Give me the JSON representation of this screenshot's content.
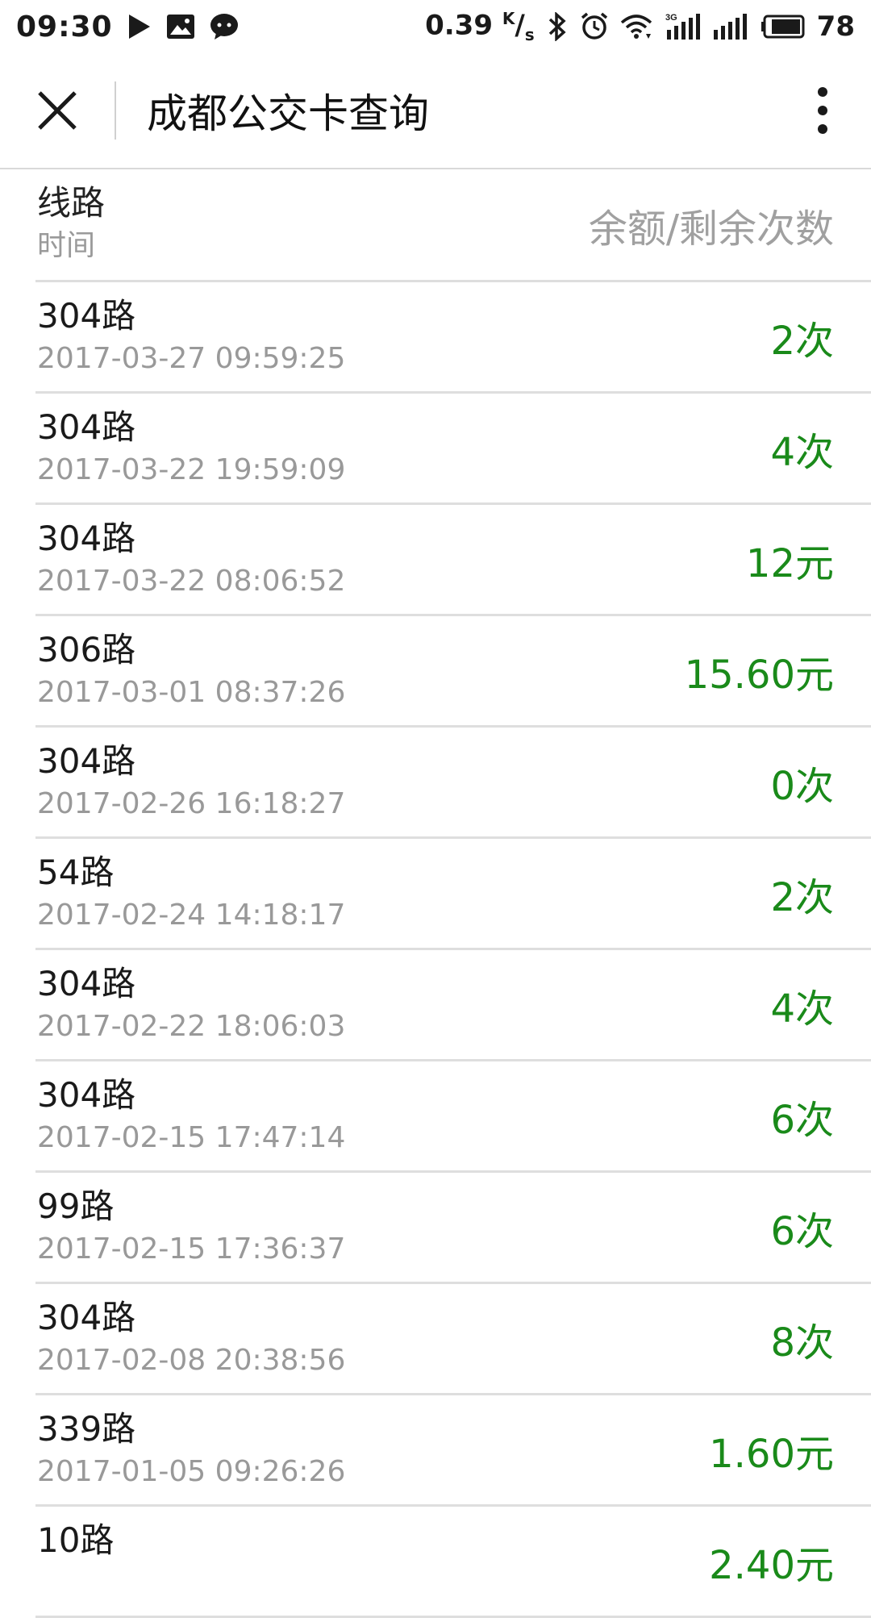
{
  "status_bar": {
    "time": "09:30",
    "speed_value": "0.39",
    "speed_unit_top": "K",
    "speed_unit_bottom": "s",
    "network_label": "3G",
    "battery": "78"
  },
  "header": {
    "title": "成都公交卡查询"
  },
  "list_header": {
    "route_label": "线路",
    "time_label": "时间",
    "amount_label": "余额/剩余次数"
  },
  "records": [
    {
      "route": "304路",
      "time": "2017-03-27 09:59:25",
      "amount": "2次"
    },
    {
      "route": "304路",
      "time": "2017-03-22 19:59:09",
      "amount": "4次"
    },
    {
      "route": "304路",
      "time": "2017-03-22 08:06:52",
      "amount": "12元"
    },
    {
      "route": "306路",
      "time": "2017-03-01 08:37:26",
      "amount": "15.60元"
    },
    {
      "route": "304路",
      "time": "2017-02-26 16:18:27",
      "amount": "0次"
    },
    {
      "route": "54路",
      "time": "2017-02-24 14:18:17",
      "amount": "2次"
    },
    {
      "route": "304路",
      "time": "2017-02-22 18:06:03",
      "amount": "4次"
    },
    {
      "route": "304路",
      "time": "2017-02-15 17:47:14",
      "amount": "6次"
    },
    {
      "route": "99路",
      "time": "2017-02-15 17:36:37",
      "amount": "6次"
    },
    {
      "route": "304路",
      "time": "2017-02-08 20:38:56",
      "amount": "8次"
    },
    {
      "route": "339路",
      "time": "2017-01-05 09:26:26",
      "amount": "1.60元"
    },
    {
      "route": "10路",
      "time": "",
      "amount": "2.40元"
    }
  ],
  "colors": {
    "amount_green": "#1a8a1a",
    "secondary_gray": "#999999"
  }
}
